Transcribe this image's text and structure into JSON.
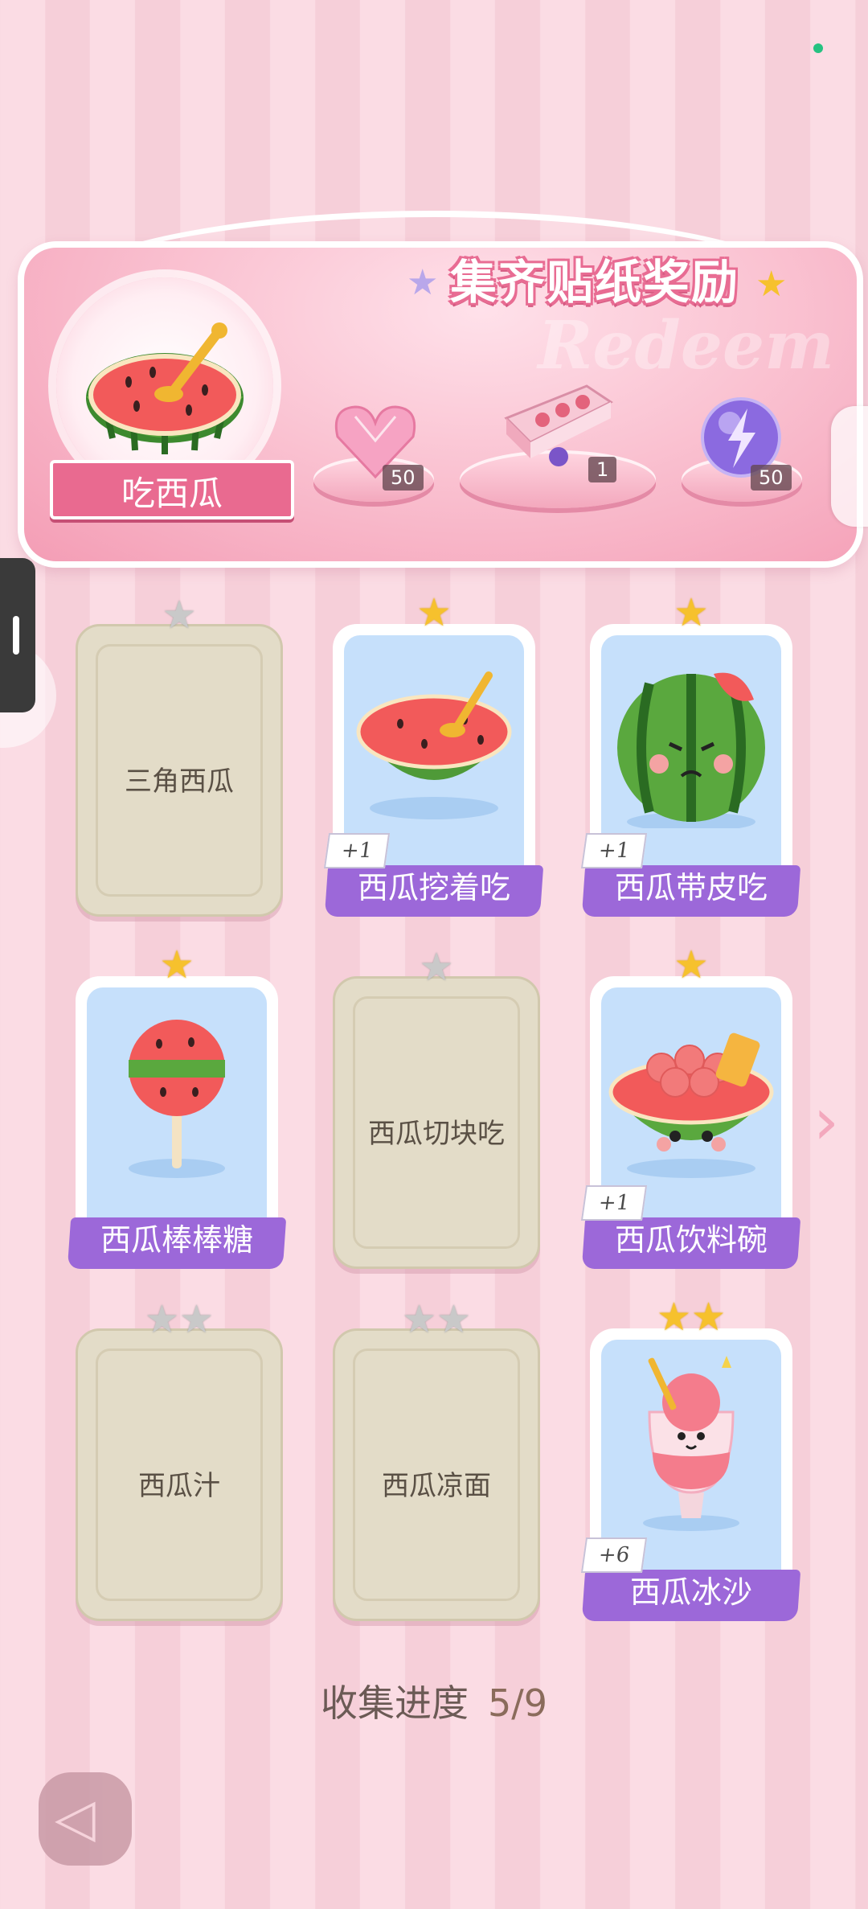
{
  "banner": {
    "title": "集齐贴纸奖励",
    "watermark": "Redeem",
    "main_reward_name": "吃西瓜",
    "rewards": [
      {
        "icon": "heart-gem-icon",
        "count": "50"
      },
      {
        "icon": "gift-box-icon",
        "count": "1"
      },
      {
        "icon": "lightning-orb-icon",
        "count": "50"
      }
    ]
  },
  "cards": [
    {
      "name": "三角西瓜",
      "stars": 1,
      "collected": false,
      "plus": ""
    },
    {
      "name": "西瓜挖着吃",
      "stars": 1,
      "collected": true,
      "plus": "+1"
    },
    {
      "name": "西瓜带皮吃",
      "stars": 1,
      "collected": true,
      "plus": "+1"
    },
    {
      "name": "西瓜棒棒糖",
      "stars": 1,
      "collected": true,
      "plus": ""
    },
    {
      "name": "西瓜切块吃",
      "stars": 1,
      "collected": false,
      "plus": ""
    },
    {
      "name": "西瓜饮料碗",
      "stars": 1,
      "collected": true,
      "plus": "+1"
    },
    {
      "name": "西瓜汁",
      "stars": 2,
      "collected": false,
      "plus": ""
    },
    {
      "name": "西瓜凉面",
      "stars": 2,
      "collected": false,
      "plus": ""
    },
    {
      "name": "西瓜冰沙",
      "stars": 2,
      "collected": true,
      "plus": "+6"
    }
  ],
  "progress": {
    "label": "收集进度",
    "value": "5/9"
  },
  "colors": {
    "ribbon_purple": "#9c68d9",
    "banner_pink": "#e96a90",
    "star_gold": "#f6c12d"
  }
}
